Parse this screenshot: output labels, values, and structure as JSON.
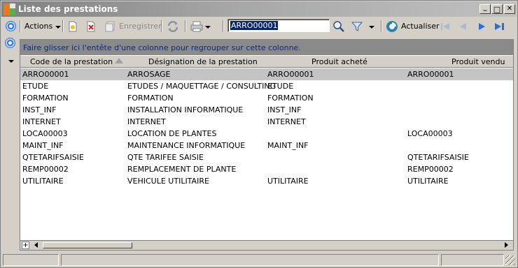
{
  "window": {
    "title": "Liste des prestations",
    "controls": {
      "minimize": "_",
      "maximize": "□",
      "close": "✕"
    }
  },
  "toolbar": {
    "actions_label": "Actions",
    "save_label": "Enregistrer",
    "refresh_label": "Actualiser",
    "search_value": "ARRO00001"
  },
  "group_panel": {
    "text": "Faire glisser ici l'entête d'une colonne pour regrouper sur cette colonne."
  },
  "table": {
    "columns": [
      "Code de la prestation",
      "Désignation de la prestation",
      "Produit acheté",
      "Produit vendu"
    ],
    "rows": [
      [
        "ARRO00001",
        "ARROSAGE",
        "ARRO00001",
        "ARRO00001"
      ],
      [
        "ETUDE",
        "ETUDES / MAQUETTAGE / CONSULTING",
        "ETUDE",
        ""
      ],
      [
        "FORMATION",
        "FORMATION",
        "FORMATION",
        ""
      ],
      [
        "INST_INF",
        "INSTALLATION INFORMATIQUE",
        "INST_INF",
        ""
      ],
      [
        "INTERNET",
        "INTERNET",
        "INTERNET",
        ""
      ],
      [
        "LOCA00003",
        "LOCATION DE PLANTES",
        "",
        "LOCA00003"
      ],
      [
        "MAINT_INF",
        "MAINTENANCE INFORMATIQUE",
        "MAINT_INF",
        ""
      ],
      [
        "QTETARIFSAISIE",
        "QTE TARIFEE SAISIE",
        "",
        "QTETARIFSAISIE"
      ],
      [
        "REMP00002",
        "REMPLACEMENT DE PLANTE",
        "",
        "REMP00002"
      ],
      [
        "UTILITAIRE",
        "VEHICULE UTILITAIRE",
        "UTILITAIRE",
        "UTILITAIRE"
      ]
    ],
    "selected_row": 0
  },
  "navigator": {
    "plus": "+"
  },
  "colors": {
    "accent": "#2a6ed8",
    "selection": "#0a246a",
    "group_panel_bg": "#8a8a8a",
    "selected_row_bg": "#c4c4c4"
  },
  "icons": [
    "app-icon",
    "options-icon",
    "new-icon",
    "delete-icon",
    "save-icon",
    "sync-icon",
    "print-icon",
    "search-icon",
    "filter-icon",
    "refresh-icon",
    "first-icon",
    "previous-icon",
    "next-icon",
    "last-icon"
  ]
}
